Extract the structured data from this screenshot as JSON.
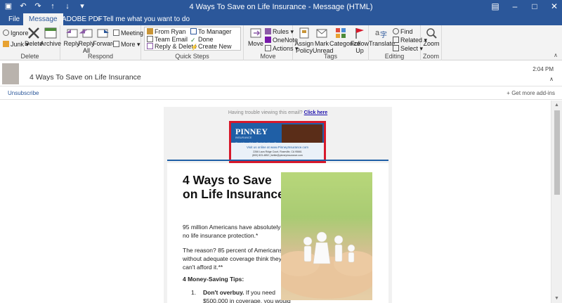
{
  "window": {
    "title": "4 Ways To Save on Life Insurance - Message (HTML)"
  },
  "tabs": [
    {
      "label": "File"
    },
    {
      "label": "Message"
    },
    {
      "label": "ADOBE PDF"
    },
    {
      "label": "Tell me what you want to do"
    }
  ],
  "ribbon": {
    "delete_group": {
      "label": "Delete",
      "ignore": "Ignore",
      "junk": "Junk",
      "delete": "Delete",
      "archive": "Archive"
    },
    "respond_group": {
      "label": "Respond",
      "reply": "Reply",
      "reply_all": "Reply All",
      "forward": "Forward",
      "meeting": "Meeting",
      "more": "More"
    },
    "quicksteps_group": {
      "label": "Quick Steps",
      "items": [
        "From Ryan",
        "Team Email",
        "Reply & Delete",
        "To Manager",
        "Done",
        "Create New"
      ]
    },
    "move_group": {
      "label": "Move",
      "move": "Move",
      "rules": "Rules",
      "onenote": "OneNote",
      "actions": "Actions"
    },
    "tags_group": {
      "label": "Tags",
      "assign_policy": "Assign Policy",
      "mark_unread": "Mark Unread",
      "categorize": "Categorize",
      "follow_up": "Follow Up"
    },
    "editing_group": {
      "label": "Editing",
      "translate": "Translate",
      "find": "Find",
      "related": "Related",
      "select": "Select"
    },
    "zoom_group": {
      "label": "Zoom",
      "zoom": "Zoom"
    }
  },
  "header": {
    "subject": "4 Ways To Save on Life Insurance",
    "time": "2:04 PM"
  },
  "infobar": {
    "unsubscribe": "Unsubscribe",
    "get_addins": "Get more add-ins"
  },
  "email": {
    "trouble_text": "Having trouble viewing this email?",
    "trouble_link": "Click here",
    "banner": {
      "logo": "PINNEY",
      "logo_sub": "INSURANCE",
      "tagline": "Providing all the Tools for Your Success!",
      "visit": "Visit us online at www.PinneyInsurance.com",
      "address": "2266 Lava Ridge Court, Roseville, CA 95661",
      "phone": "(800) 823-4852 | kettie@pinneyinsurance.com"
    },
    "heading": "4 Ways to Save on Life Insurance",
    "para1": "95 million Americans have absolutely no life insurance protection.*",
    "para2": "The reason? 85 percent of Americans without adequate coverage think they can't afford it.**",
    "tips_heading": "4 Money-Saving Tips:",
    "tip1_num": "1.",
    "tip1_bold": "Don't overbuy.",
    "tip1_text": " If you need $500,000 in coverage, you would"
  },
  "colors": {
    "brand_blue": "#2b579a",
    "highlight_red": "#d7192b"
  }
}
